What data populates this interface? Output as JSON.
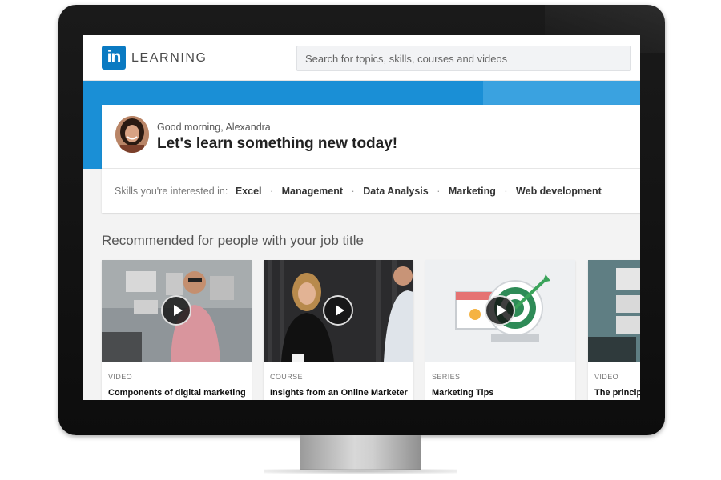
{
  "header": {
    "logo_mark": "in",
    "logo_text": "LEARNING",
    "search_placeholder": "Search for topics, skills, courses and videos"
  },
  "greeting": {
    "subtitle": "Good morning, Alexandra",
    "headline": "Let's learn something new today!",
    "skills_label": "Skills you're interested in:",
    "skills": [
      "Excel",
      "Management",
      "Data Analysis",
      "Marketing",
      "Web development"
    ]
  },
  "recommended": {
    "title": "Recommended for people with your job title",
    "courses": [
      {
        "type": "VIDEO",
        "title": "Components of digital marketing"
      },
      {
        "type": "COURSE",
        "title": "Insights from an Online Marketer"
      },
      {
        "type": "SERIES",
        "title": "Marketing Tips"
      },
      {
        "type": "VIDEO",
        "title": "The principl"
      }
    ]
  },
  "colors": {
    "brand_blue": "#0a7ac2",
    "banner_blue": "#1a8fd6"
  }
}
